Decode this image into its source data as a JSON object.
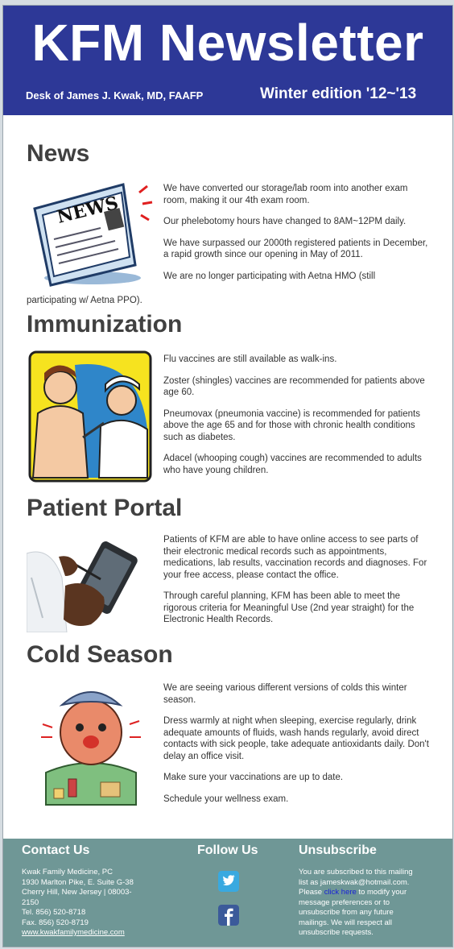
{
  "header": {
    "title": "KFM Newsletter",
    "desk": "Desk of James J. Kwak, MD, FAAFP",
    "edition": "Winter edition '12~'13"
  },
  "sections": [
    {
      "title": "News",
      "image": "newspaper-illustration",
      "paragraphs": [
        "We have converted our storage/lab room into another exam room, making it our 4th exam room.",
        "Our phelebotomy hours have changed to 8AM~12PM daily.",
        "We have surpassed our 2000th registered patients in December, a rapid growth since our opening in May of 2011.",
        "We are no longer participating with Aetna HMO (still",
        "participating w/  Aetna PPO)."
      ]
    },
    {
      "title": "Immunization",
      "image": "vaccination-illustration",
      "paragraphs": [
        "Flu vaccines are still available as walk-ins.",
        "Zoster (shingles) vaccines are recommended for patients above age 60.",
        "Pneumovax (pneumonia vaccine) is recommended for patients above the age 65 and for those with chronic health conditions such as diabetes.",
        "Adacel (whooping cough) vaccines are recommended to adults who have young children."
      ]
    },
    {
      "title": "Patient Portal",
      "image": "tablet-doctor-photo",
      "paragraphs": [
        "Patients of KFM are able to have online access to see parts of their electronic medical records such as appointments, medications, lab results, vaccination records and diagnoses.  For your free access, please contact the office.",
        "Through careful planning, KFM has been able to meet the rigorous criteria for Meaningful Use (2nd year straight) for the Electronic Health Records."
      ]
    },
    {
      "title": "Cold Season",
      "image": "sick-man-illustration",
      "paragraphs": [
        "We are seeing various different versions of colds this winter season.",
        "Dress warmly at night when sleeping, exercise regularly, drink adequate amounts of fluids, wash hands regularly, avoid direct contacts with sick people, take adequate antioxidants daily.  Don't delay an office visit.",
        "Make sure your vaccinations are up to date.",
        "Schedule your wellness exam."
      ]
    }
  ],
  "footer": {
    "contact": {
      "title": "Contact Us",
      "lines": [
        "Kwak Family Medicine, PC",
        "1930 Marlton Pike, E. Suite G-38",
        "Cherry Hill, New Jersey | 08003-",
        "2150",
        "Tel. 856) 520-8718",
        "Fax. 856) 520-8719"
      ],
      "website": "www.kwakfamilymedicine.com"
    },
    "follow": {
      "title": "Follow Us",
      "icons": [
        "twitter-icon",
        "facebook-icon"
      ]
    },
    "unsubscribe": {
      "title": "Unsubscribe",
      "line1": "You are subscribed to this mailing",
      "line2": "list as jameskwak@hotmail.com.",
      "line3_before": "Please ",
      "link": "click here",
      "line3_after": " to modify your",
      "rest": [
        "message preferences or to",
        "unsubscribe from any future",
        "mailings. We will respect all",
        "unsubscribe requests."
      ]
    }
  },
  "colors": {
    "header_bg": "#2d3897",
    "footer_bg": "#6f9796",
    "heading": "#404040",
    "link": "#1a24d6"
  }
}
